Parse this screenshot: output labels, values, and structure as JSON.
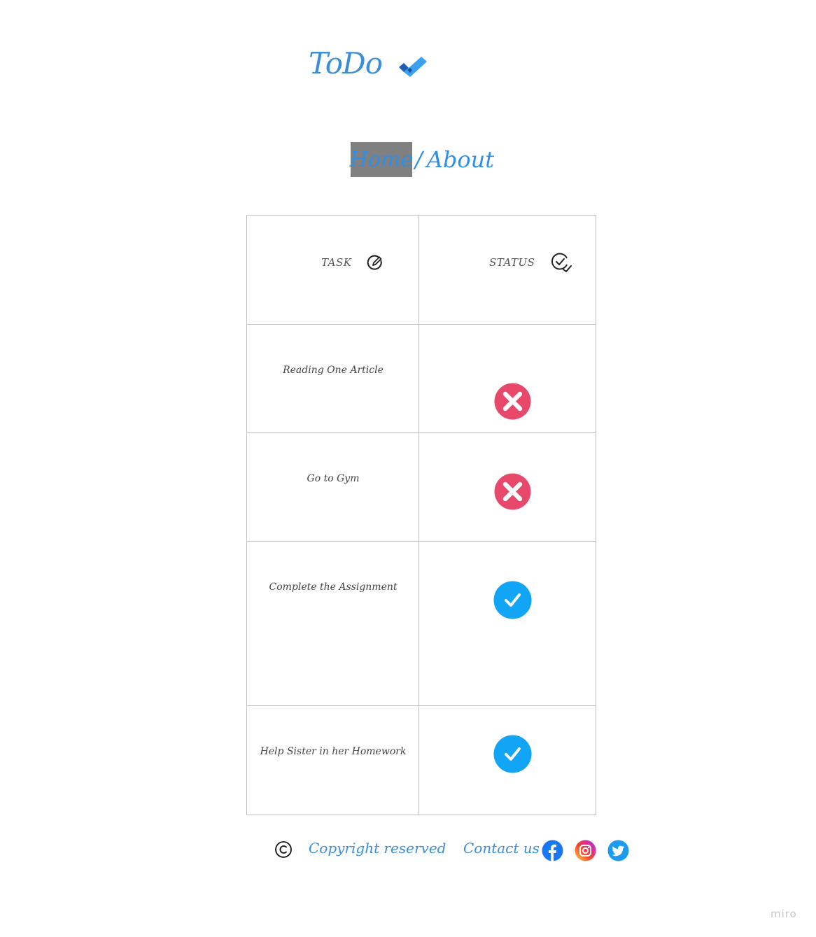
{
  "header": {
    "title": "ToDo",
    "logo_icon": "double-check-icon"
  },
  "nav": {
    "home_label": "Home",
    "separator": "/",
    "about_label": "About",
    "active": "Home"
  },
  "table": {
    "columns": [
      {
        "label": "TASK",
        "icon": "edit-circle-icon"
      },
      {
        "label": "STATUS",
        "icon": "check-circle-icon"
      }
    ],
    "rows": [
      {
        "task": "Reading One Article",
        "status": "incomplete",
        "status_icon": "x-circle-icon"
      },
      {
        "task": "Go to Gym",
        "status": "incomplete",
        "status_icon": "x-circle-icon"
      },
      {
        "task": "Complete the Assignment",
        "status": "complete",
        "status_icon": "check-circle-icon"
      },
      {
        "task": "Help Sister in her Homework",
        "status": "complete",
        "status_icon": "check-circle-icon"
      }
    ]
  },
  "footer": {
    "copyright_icon": "copyright-icon",
    "copyright_text": "Copyright reserved",
    "contact_label": "Contact us :",
    "social": [
      "facebook-icon",
      "instagram-icon",
      "twitter-icon"
    ]
  },
  "watermark": "miro",
  "colors": {
    "accent": "#3b8fd9",
    "incomplete": "#e8486a",
    "complete": "#12a4f5",
    "nav_active_bg": "#808080"
  }
}
